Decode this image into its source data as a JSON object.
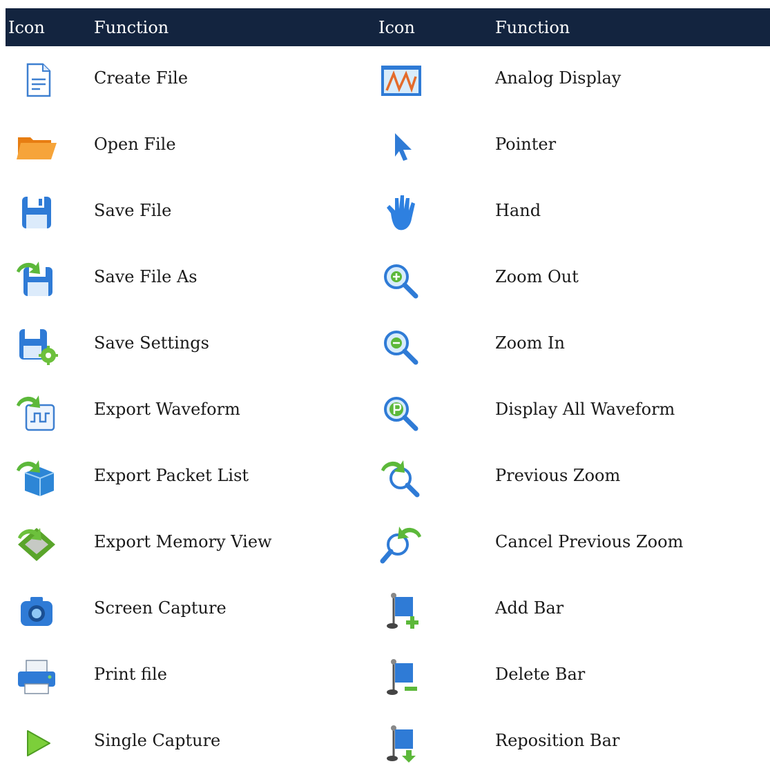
{
  "header": {
    "col1": "Icon",
    "col2": "Function",
    "col3": "Icon",
    "col4": "Function"
  },
  "rows": [
    {
      "left": {
        "icon": "create-file-icon",
        "label": "Create File"
      },
      "right": {
        "icon": "analog-display-icon",
        "label": "Analog Display"
      }
    },
    {
      "left": {
        "icon": "open-file-icon",
        "label": "Open File"
      },
      "right": {
        "icon": "pointer-icon",
        "label": "Pointer"
      }
    },
    {
      "left": {
        "icon": "save-file-icon",
        "label": "Save File"
      },
      "right": {
        "icon": "hand-icon",
        "label": "Hand"
      }
    },
    {
      "left": {
        "icon": "save-file-as-icon",
        "label": "Save File As"
      },
      "right": {
        "icon": "zoom-out-icon",
        "label": "Zoom Out"
      }
    },
    {
      "left": {
        "icon": "save-settings-icon",
        "label": "Save Settings"
      },
      "right": {
        "icon": "zoom-in-icon",
        "label": "Zoom In"
      }
    },
    {
      "left": {
        "icon": "export-waveform-icon",
        "label": "Export Waveform"
      },
      "right": {
        "icon": "display-all-waveform-icon",
        "label": "Display All Waveform"
      }
    },
    {
      "left": {
        "icon": "export-packet-list-icon",
        "label": "Export Packet List"
      },
      "right": {
        "icon": "previous-zoom-icon",
        "label": "Previous Zoom"
      }
    },
    {
      "left": {
        "icon": "export-memory-view-icon",
        "label": "Export Memory View"
      },
      "right": {
        "icon": "cancel-previous-zoom-icon",
        "label": "Cancel Previous Zoom"
      }
    },
    {
      "left": {
        "icon": "screen-capture-icon",
        "label": "Screen Capture"
      },
      "right": {
        "icon": "add-bar-icon",
        "label": "Add Bar"
      }
    },
    {
      "left": {
        "icon": "print-file-icon",
        "label": "Print file"
      },
      "right": {
        "icon": "delete-bar-icon",
        "label": "Delete Bar"
      }
    },
    {
      "left": {
        "icon": "single-capture-icon",
        "label": "Single Capture"
      },
      "right": {
        "icon": "reposition-bar-icon",
        "label": "Reposition Bar"
      }
    }
  ],
  "colors": {
    "header_bg": "#13243f",
    "header_text": "#ffffff",
    "body_text": "#1a1a1a"
  }
}
